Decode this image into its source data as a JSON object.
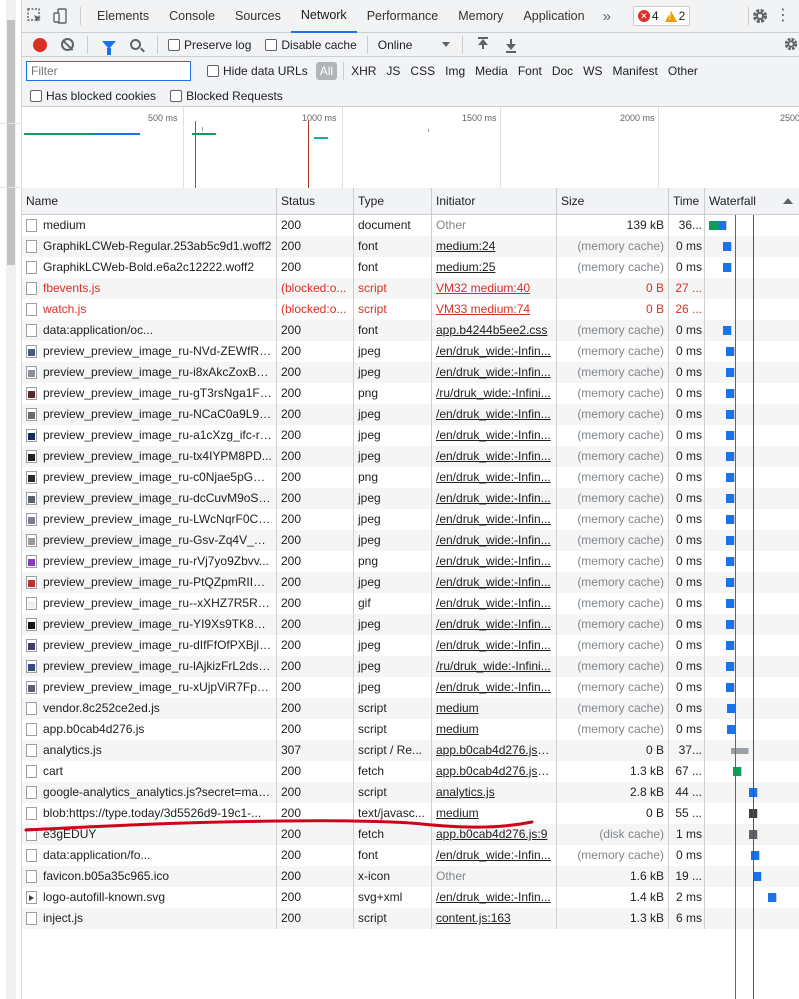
{
  "tabs": [
    "Elements",
    "Console",
    "Sources",
    "Network",
    "Performance",
    "Memory",
    "Application"
  ],
  "active_tab": "Network",
  "more_tabs": "»",
  "errors_count": "4",
  "warnings_count": "2",
  "toolbar": {
    "preserve_log": "Preserve log",
    "disable_cache": "Disable cache",
    "throttling": "Online"
  },
  "filter": {
    "placeholder": "Filter",
    "hide_data_urls": "Hide data URLs",
    "all": "All",
    "types": [
      "XHR",
      "JS",
      "CSS",
      "Img",
      "Media",
      "Font",
      "Doc",
      "WS",
      "Manifest",
      "Other"
    ],
    "has_blocked_cookies": "Has blocked cookies",
    "blocked_requests": "Blocked Requests"
  },
  "overview": {
    "labels": [
      "500 ms",
      "1000 ms",
      "1500 ms",
      "2000 ms",
      "2500"
    ]
  },
  "columns": {
    "name": "Name",
    "status": "Status",
    "type": "Type",
    "initiator": "Initiator",
    "size": "Size",
    "time": "Time",
    "waterfall": "Waterfall"
  },
  "rows": [
    {
      "name": "medium",
      "status": "200",
      "type": "document",
      "initiator": "Other",
      "size": "139 kB",
      "time": "36...",
      "icon": "doc"
    },
    {
      "name": "GraphikLCWeb-Regular.253ab5c9d1.woff2",
      "status": "200",
      "type": "font",
      "initiator": "medium:24",
      "size": "(memory cache)",
      "time": "0 ms",
      "icon": "doc"
    },
    {
      "name": "GraphikLCWeb-Bold.e6a2c12222.woff2",
      "status": "200",
      "type": "font",
      "initiator": "medium:25",
      "size": "(memory cache)",
      "time": "0 ms",
      "icon": "doc"
    },
    {
      "name": "fbevents.js",
      "status": "(blocked:o...",
      "type": "script",
      "initiator": "VM32 medium:40",
      "size": "0 B",
      "time": "27 ...",
      "icon": "doc",
      "blocked": true
    },
    {
      "name": "watch.js",
      "status": "(blocked:o...",
      "type": "script",
      "initiator": "VM33 medium:74",
      "size": "0 B",
      "time": "26 ...",
      "icon": "doc",
      "blocked": true
    },
    {
      "name": "data:application/oc...",
      "status": "200",
      "type": "font",
      "initiator": "app.b4244b5ee2.css",
      "size": "(memory cache)",
      "time": "0 ms",
      "icon": "doc"
    },
    {
      "name": "preview_preview_image_ru-NVd-ZEWfRS...",
      "status": "200",
      "type": "jpeg",
      "initiator": "/en/druk_wide:-Infin...",
      "size": "(memory cache)",
      "time": "0 ms",
      "icon": "img",
      "thumb": "#4a5a7a"
    },
    {
      "name": "preview_preview_image_ru-i8xAkcZoxBF...",
      "status": "200",
      "type": "jpeg",
      "initiator": "/en/druk_wide:-Infin...",
      "size": "(memory cache)",
      "time": "0 ms",
      "icon": "img",
      "thumb": "#8a8f99"
    },
    {
      "name": "preview_preview_image_ru-gT3rsNga1F6...",
      "status": "200",
      "type": "png",
      "initiator": "/ru/druk_wide:-Infini...",
      "size": "(memory cache)",
      "time": "0 ms",
      "icon": "img",
      "thumb": "#5a2a2a"
    },
    {
      "name": "preview_preview_image_ru-NCaC0a9L9B...",
      "status": "200",
      "type": "jpeg",
      "initiator": "/en/druk_wide:-Infin...",
      "size": "(memory cache)",
      "time": "0 ms",
      "icon": "img",
      "thumb": "#6b6b6b"
    },
    {
      "name": "preview_preview_image_ru-a1cXzg_ifc-rx...",
      "status": "200",
      "type": "jpeg",
      "initiator": "/en/druk_wide:-Infin...",
      "size": "(memory cache)",
      "time": "0 ms",
      "icon": "img",
      "thumb": "#1a2a5a"
    },
    {
      "name": "preview_preview_image_ru-tx4IYPM8PD...",
      "status": "200",
      "type": "jpeg",
      "initiator": "/en/druk_wide:-Infin...",
      "size": "(memory cache)",
      "time": "0 ms",
      "icon": "img",
      "thumb": "#222222"
    },
    {
      "name": "preview_preview_image_ru-c0Njae5pGW...",
      "status": "200",
      "type": "png",
      "initiator": "/en/druk_wide:-Infin...",
      "size": "(memory cache)",
      "time": "0 ms",
      "icon": "img",
      "thumb": "#2a2a2a"
    },
    {
      "name": "preview_preview_image_ru-dcCuvM9oS2...",
      "status": "200",
      "type": "jpeg",
      "initiator": "/en/druk_wide:-Infin...",
      "size": "(memory cache)",
      "time": "0 ms",
      "icon": "img",
      "thumb": "#5a5f6a"
    },
    {
      "name": "preview_preview_image_ru-LWcNqrF0C7...",
      "status": "200",
      "type": "jpeg",
      "initiator": "/en/druk_wide:-Infin...",
      "size": "(memory cache)",
      "time": "0 ms",
      "icon": "img",
      "thumb": "#7a8090"
    },
    {
      "name": "preview_preview_image_ru-Gsv-Zq4V_G...",
      "status": "200",
      "type": "jpeg",
      "initiator": "/en/druk_wide:-Infin...",
      "size": "(memory cache)",
      "time": "0 ms",
      "icon": "img",
      "thumb": "#9a9a9a"
    },
    {
      "name": "preview_preview_image_ru-rVj7yo9Zbvv...",
      "status": "200",
      "type": "png",
      "initiator": "/en/druk_wide:-Infin...",
      "size": "(memory cache)",
      "time": "0 ms",
      "icon": "img",
      "thumb": "#8a3ac0"
    },
    {
      "name": "preview_preview_image_ru-PtQZpmRIIZq...",
      "status": "200",
      "type": "jpeg",
      "initiator": "/en/druk_wide:-Infin...",
      "size": "(memory cache)",
      "time": "0 ms",
      "icon": "img",
      "thumb": "#c03030"
    },
    {
      "name": "preview_preview_image_ru--xXHZ7R5Rz...",
      "status": "200",
      "type": "gif",
      "initiator": "/en/druk_wide:-Infin...",
      "size": "(memory cache)",
      "time": "0 ms",
      "icon": "img",
      "thumb": "#f0f0f0"
    },
    {
      "name": "preview_preview_image_ru-YI9Xs9TK8Vc...",
      "status": "200",
      "type": "jpeg",
      "initiator": "/en/druk_wide:-Infin...",
      "size": "(memory cache)",
      "time": "0 ms",
      "icon": "img",
      "thumb": "#151515"
    },
    {
      "name": "preview_preview_image_ru-dIfFfOfPXBjly...",
      "status": "200",
      "type": "jpeg",
      "initiator": "/en/druk_wide:-Infin...",
      "size": "(memory cache)",
      "time": "0 ms",
      "icon": "img",
      "thumb": "#4a3a6a"
    },
    {
      "name": "preview_preview_image_ru-lAjkizFrL2dsU...",
      "status": "200",
      "type": "jpeg",
      "initiator": "/ru/druk_wide:-Infini...",
      "size": "(memory cache)",
      "time": "0 ms",
      "icon": "img",
      "thumb": "#3a4a7a"
    },
    {
      "name": "preview_preview_image_ru-xUjpViR7Fpty...",
      "status": "200",
      "type": "jpeg",
      "initiator": "/en/druk_wide:-Infin...",
      "size": "(memory cache)",
      "time": "0 ms",
      "icon": "img",
      "thumb": "#5a6070"
    },
    {
      "name": "vendor.8c252ce2ed.js",
      "status": "200",
      "type": "script",
      "initiator": "medium",
      "size": "(memory cache)",
      "time": "0 ms",
      "icon": "doc"
    },
    {
      "name": "app.b0cab4d276.js",
      "status": "200",
      "type": "script",
      "initiator": "medium",
      "size": "(memory cache)",
      "time": "0 ms",
      "icon": "doc"
    },
    {
      "name": "analytics.js",
      "status": "307",
      "type": "script / Re...",
      "initiator": "app.b0cab4d276.js:27",
      "size": "0 B",
      "time": "37...",
      "icon": "doc"
    },
    {
      "name": "cart",
      "status": "200",
      "type": "fetch",
      "initiator": "app.b0cab4d276.js:32",
      "size": "1.3 kB",
      "time": "67 ...",
      "icon": "doc"
    },
    {
      "name": "google-analytics_analytics.js?secret=max...",
      "status": "200",
      "type": "script",
      "initiator": "analytics.js",
      "size": "2.8 kB",
      "time": "44 ...",
      "icon": "doc"
    },
    {
      "name": "blob:https://type.today/3d5526d9-19c1-...",
      "status": "200",
      "type": "text/javasc...",
      "initiator": "medium",
      "size": "0 B",
      "time": "55 ...",
      "icon": "doc"
    },
    {
      "name": "e3gEDUY",
      "status": "200",
      "type": "fetch",
      "initiator": "app.b0cab4d276.js:9",
      "size": "(disk cache)",
      "time": "1 ms",
      "icon": "doc"
    },
    {
      "name": "data:application/fo...",
      "status": "200",
      "type": "font",
      "initiator": "/en/druk_wide:-Infin...",
      "size": "(memory cache)",
      "time": "0 ms",
      "icon": "doc"
    },
    {
      "name": "favicon.b05a35c965.ico",
      "status": "200",
      "type": "x-icon",
      "initiator": "Other",
      "size": "1.6 kB",
      "time": "19 ...",
      "icon": "doc"
    },
    {
      "name": "logo-autofill-known.svg",
      "status": "200",
      "type": "svg+xml",
      "initiator": "/en/druk_wide:-Infin...",
      "size": "1.4 kB",
      "time": "2 ms",
      "icon": "svg"
    },
    {
      "name": "inject.js",
      "status": "200",
      "type": "script",
      "initiator": "content.js:163",
      "size": "1.3 kB",
      "time": "6 ms",
      "icon": "doc"
    }
  ],
  "colors": {
    "accent": "#1a73e8",
    "error": "#d93025",
    "annotation": "#d0021b"
  }
}
